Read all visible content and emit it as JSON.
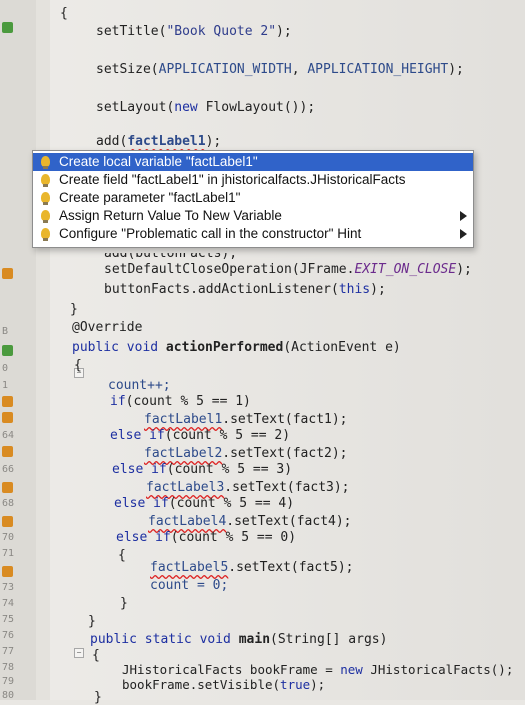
{
  "editor": {
    "top_brace": "{",
    "lines_top": {
      "set_title": {
        "call": "setTitle(",
        "arg": "\"Book Quote 2\"",
        "tail": ");"
      },
      "set_size": {
        "call": "setSize(",
        "arg1": "APPLICATION_WIDTH",
        "sep": ", ",
        "arg2": "APPLICATION_HEIGHT",
        "tail": ");"
      },
      "set_layout": {
        "call": "setLayout(",
        "kw": "new",
        "rest": " FlowLayout());"
      },
      "add_call": {
        "call": "add(",
        "arg": "factLabel1",
        "tail": ");"
      }
    },
    "lines_partial": {
      "add_button": "add(buttonFacts);",
      "default_close": {
        "call": "setDefaultCloseOperation(JFrame.",
        "const": "EXIT_ON_CLOSE",
        "tail": ");"
      },
      "add_listener": {
        "obj": "buttonFacts",
        "rest": ".addActionListener(",
        "kw": "this",
        "tail": ");"
      }
    },
    "closing_brace": "}",
    "override": "@Override",
    "action_sig": {
      "kw": "public void ",
      "name": "actionPerformed",
      "params": "(ActionEvent e)"
    },
    "open_brace": "{",
    "body": {
      "count_inc": "count++;",
      "if1": {
        "kw": "if",
        "cond": "(count % 5 == 1)"
      },
      "set1": {
        "obj": "factLabel1",
        "rest": ".setText(fact1);"
      },
      "else_if2": {
        "kw": "else if",
        "cond": "(count % 5 == 2)"
      },
      "set2": {
        "obj": "factLabel2",
        "rest": ".setText(fact2);"
      },
      "else_if3": {
        "kw": "else if",
        "cond": "(count % 5 == 3)"
      },
      "set3": {
        "obj": "factLabel3",
        "rest": ".setText(fact3);"
      },
      "else_if4": {
        "kw": "else if",
        "cond": "(count % 5 == 4)"
      },
      "set4": {
        "obj": "factLabel4",
        "rest": ".setText(fact4);"
      },
      "else_if0": {
        "kw": "else if",
        "cond": "(count % 5 == 0)"
      },
      "brace_open": "{",
      "set5": {
        "obj": "factLabel5",
        "rest": ".setText(fact5);"
      },
      "count_reset": "count = 0;",
      "brace_close": "}"
    },
    "method_close": "}",
    "main_sig": {
      "kw": "public static void ",
      "name": "main",
      "params": "(String[] args)"
    },
    "main_open": "{",
    "main_body": {
      "book_frame": {
        "pre": "JHistoricalFacts bookFrame = ",
        "kw": "new",
        "rest": " JHistoricalFacts();"
      },
      "set_visible": {
        "pre": "bookFrame.setVisible(",
        "kw": "true",
        "tail": ");"
      }
    },
    "main_close": "}"
  },
  "line_numbers": [
    "1",
    "64",
    "66",
    "68",
    "70",
    "71",
    "73",
    "74",
    "75",
    "76",
    "77",
    "78",
    "79",
    "80"
  ],
  "gutter_misc": [
    "B",
    "0",
    "0"
  ],
  "popup": {
    "items": [
      {
        "label": "Create local variable \"factLabel1\"",
        "selected": true,
        "has_submenu": false
      },
      {
        "label": "Create field \"factLabel1\" in jhistoricalfacts.JHistoricalFacts",
        "selected": false,
        "has_submenu": false
      },
      {
        "label": "Create parameter \"factLabel1\"",
        "selected": false,
        "has_submenu": false
      },
      {
        "label": "Assign Return Value To New Variable",
        "selected": false,
        "has_submenu": true
      },
      {
        "label": "Configure \"Problematic call in the constructor\" Hint",
        "selected": false,
        "has_submenu": true
      }
    ]
  },
  "colors": {
    "selection": "#3063c9",
    "keyword": "#1d2fa1",
    "constant": "#6b2a8c",
    "error_underline": "#dd2222",
    "hint_bulb": "#e9b62c"
  }
}
